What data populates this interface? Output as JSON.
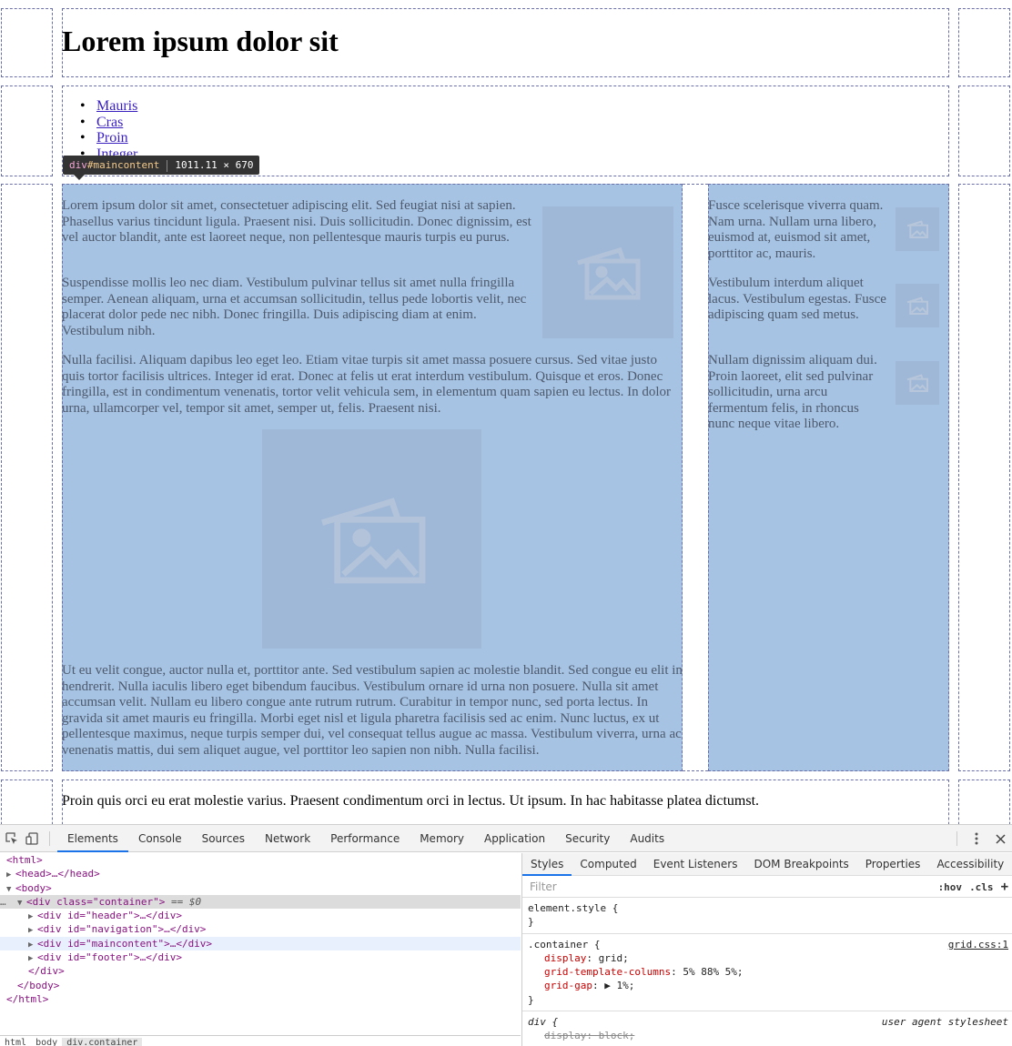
{
  "page": {
    "heading": "Lorem ipsum dolor sit",
    "nav_items": [
      "Mauris",
      "Cras",
      "Proin",
      "Integer"
    ],
    "main_paragraphs": [
      "Lorem ipsum dolor sit amet, consectetuer adipiscing elit. Sed feugiat nisi at sapien. Phasellus varius tincidunt ligula. Praesent nisi. Duis sollicitudin. Donec dignissim, est vel auctor blandit, ante est laoreet neque, non pellentesque mauris turpis eu purus.",
      "Suspendisse mollis leo nec diam. Vestibulum pulvinar tellus sit amet nulla fringilla semper. Aenean aliquam, urna et accumsan sollicitudin, tellus pede lobortis velit, nec placerat dolor pede nec nibh. Donec fringilla. Duis adipiscing diam at enim. Vestibulum nibh.",
      "Nulla facilisi. Aliquam dapibus leo eget leo. Etiam vitae turpis sit amet massa posuere cursus. Sed vitae justo quis tortor facilisis ultrices. Integer id erat. Donec at felis ut erat interdum vestibulum. Quisque et eros. Donec fringilla, est in condimentum venenatis, tortor velit vehicula sem, in elementum quam sapien eu lectus. In dolor urna, ullamcorper vel, tempor sit amet, semper ut, felis. Praesent nisi.",
      "Ut eu velit congue, auctor nulla et, porttitor ante. Sed vestibulum sapien ac molestie blandit. Sed congue eu elit in hendrerit. Nulla iaculis libero eget bibendum faucibus. Vestibulum ornare id urna non posuere. Nulla sit amet accumsan velit. Nullam eu libero congue ante rutrum rutrum. Curabitur in tempor nunc, sed porta lectus. In gravida sit amet mauris eu fringilla. Morbi eget nisl et ligula pharetra facilisis sed ac enim. Nunc luctus, ex ut pellentesque maximus, neque turpis semper dui, vel consequat tellus augue ac massa. Vestibulum viverra, urna ac venenatis mattis, dui sem aliquet augue, vel porttitor leo sapien non nibh. Nulla facilisi."
    ],
    "side_paragraphs": [
      "Fusce scelerisque viverra quam. Nam urna. Nullam urna libero, euismod at, euismod sit amet, porttitor ac, mauris.",
      "Vestibulum interdum aliquet lacus. Vestibulum egestas. Fusce adipiscing quam sed metus.",
      "Nullam dignissim aliquam dui. Proin laoreet, elit sed pulvinar sollicitudin, urna arcu fermentum felis, in rhoncus nunc neque vitae libero."
    ],
    "footer_text": "Proin quis orci eu erat molestie varius. Praesent condimentum orci in lectus. Ut ipsum. In hac habitasse platea dictumst."
  },
  "inspector_tooltip": {
    "tag": "div",
    "id": "#maincontent",
    "size": "1011.11 × 670"
  },
  "devtools": {
    "tabs": [
      "Elements",
      "Console",
      "Sources",
      "Network",
      "Performance",
      "Memory",
      "Application",
      "Security",
      "Audits"
    ],
    "active_tab": "Elements",
    "dom": {
      "html_open": "<html>",
      "head": "<head>…</head>",
      "body_open": "<body>",
      "container_open": "<div class=\"container\">",
      "selected_marker": "== $0",
      "children": [
        "<div id=\"header\">…</div>",
        "<div id=\"navigation\">…</div>",
        "<div id=\"maincontent\">…</div>",
        "<div id=\"footer\">…</div>"
      ],
      "div_close": "</div>",
      "body_close": "</body>",
      "html_close": "</html>"
    },
    "breadcrumbs": [
      "html",
      "body",
      "div.container"
    ],
    "styles_tabs": [
      "Styles",
      "Computed",
      "Event Listeners",
      "DOM Breakpoints",
      "Properties",
      "Accessibility"
    ],
    "filter_placeholder": "Filter",
    "filter_buttons": [
      ":hov",
      ".cls",
      "+"
    ],
    "rules": {
      "element_style": "element.style {",
      "close_brace": "}",
      "container_selector": ".container {",
      "container_source": "grid.css:1",
      "container_decls": [
        {
          "prop": "display",
          "val": "grid;"
        },
        {
          "prop": "grid-template-columns",
          "val": "5% 88% 5%;"
        },
        {
          "prop": "grid-gap",
          "val": "▶ 1%;"
        }
      ],
      "div_selector": "div {",
      "div_source": "user agent stylesheet",
      "div_decl": "display: block;"
    }
  }
}
